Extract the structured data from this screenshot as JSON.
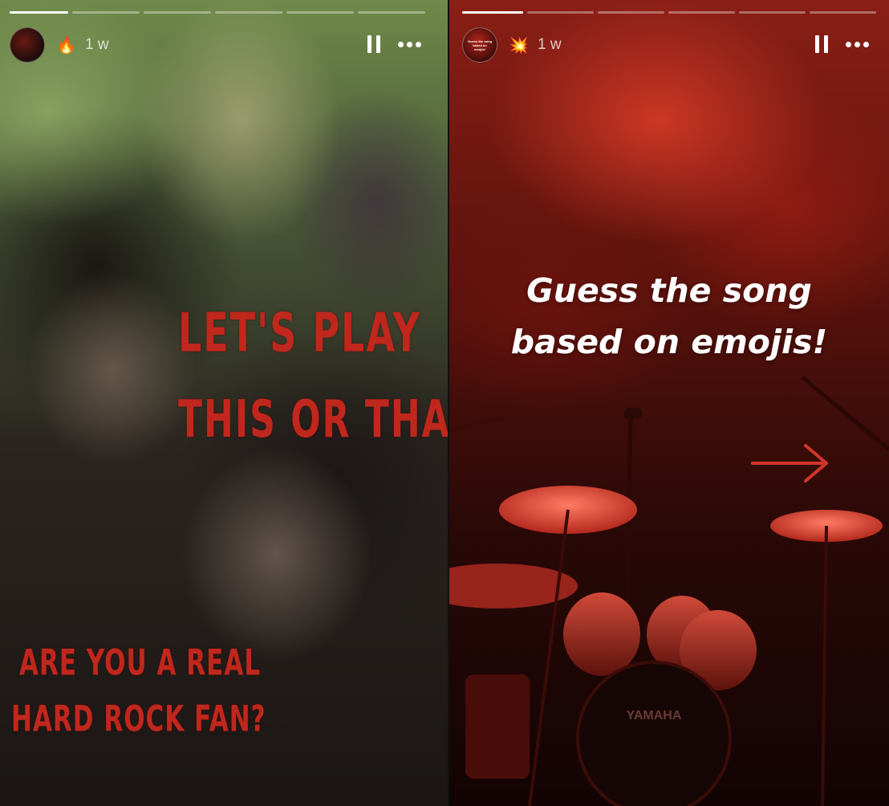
{
  "stories": [
    {
      "progress_segments": [
        1,
        0,
        0,
        0,
        0,
        0
      ],
      "header": {
        "emoji": "🔥",
        "time": "1 w"
      },
      "title_lines": [
        "LET'S PLAY",
        "THIS OR THAT"
      ],
      "subtitle_lines": [
        "ARE YOU A REAL",
        "HARD ROCK FAN?"
      ]
    },
    {
      "progress_segments": [
        1,
        0,
        0,
        0,
        0,
        0
      ],
      "header": {
        "emoji": "💥",
        "time": "1 w",
        "avatar_text": "Guess the song based on emojis!"
      },
      "prompt_lines": [
        "Guess the song",
        "based on emojis!"
      ],
      "drum_brand": "YAMAHA"
    }
  ],
  "icons": {
    "pause": "pause-icon",
    "more": "more-options-icon",
    "arrow": "right-arrow-icon"
  },
  "colors": {
    "grunge_text": "#c0271d",
    "stage_red": "#8a1f16",
    "arrow": "#d2352a"
  }
}
